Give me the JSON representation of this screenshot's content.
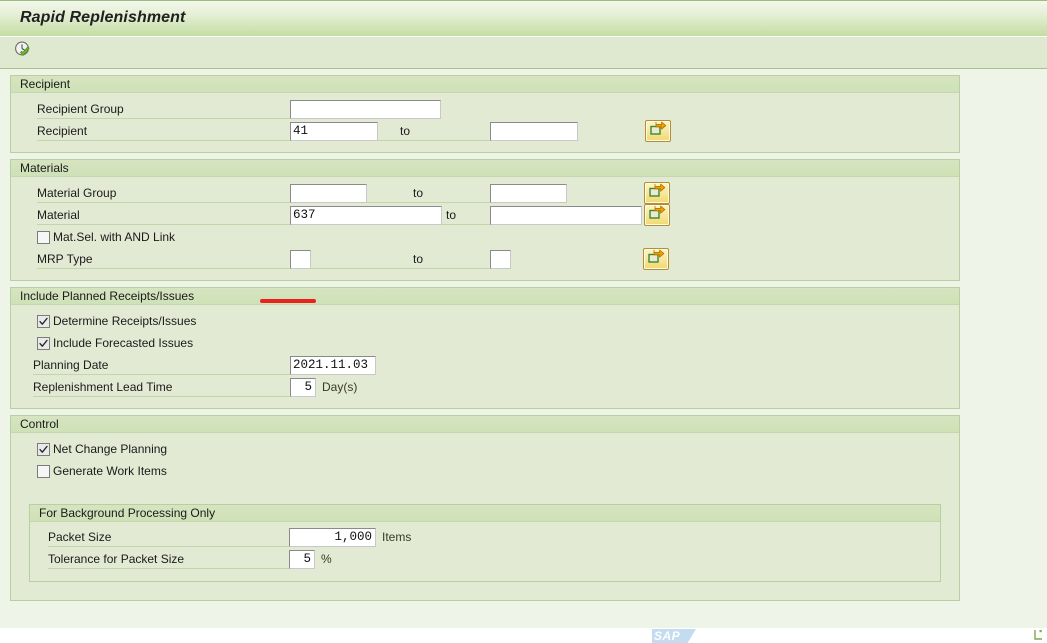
{
  "window": {
    "title": "Rapid Replenishment"
  },
  "toolbar": {
    "execute_button_label": "",
    "execute_icon": "clock-check-icon",
    "execute_tooltip": "Execute"
  },
  "common": {
    "to_label": "to",
    "multi_select_icon": "multi-selection-arrow-icon"
  },
  "sections": {
    "recipient": {
      "title": "Recipient",
      "fields": {
        "recipient_group": {
          "label": "Recipient Group",
          "value": "",
          "placeholder": ""
        },
        "recipient": {
          "label": "Recipient",
          "value": "41",
          "to_value": "",
          "to_label": "to",
          "placeholder": ""
        }
      }
    },
    "materials": {
      "title": "Materials",
      "fields": {
        "material_group": {
          "label": "Material Group",
          "value": "",
          "to_value": "",
          "to_label": "to"
        },
        "material": {
          "label": "Material",
          "value": "637",
          "to_value": "",
          "to_label": "to"
        },
        "mat_sel_and_link": {
          "label": "Mat.Sel. with AND Link",
          "checked": false
        },
        "mrp_type": {
          "label": "MRP Type",
          "value": "",
          "to_value": "",
          "to_label": "to"
        }
      }
    },
    "include_planned": {
      "title": "Include Planned Receipts/Issues",
      "fields": {
        "determine_receipts": {
          "label": "Determine Receipts/Issues",
          "checked": true
        },
        "include_forecasted": {
          "label": "Include Forecasted Issues",
          "checked": true
        },
        "planning_date": {
          "label": "Planning Date",
          "value": "2021.11.03"
        },
        "lead_time": {
          "label": "Replenishment Lead Time",
          "value": "5",
          "unit": "Day(s)"
        }
      }
    },
    "control": {
      "title": "Control",
      "fields": {
        "net_change_planning": {
          "label": "Net Change Planning",
          "checked": true
        },
        "generate_work_items": {
          "label": "Generate Work Items",
          "checked": false
        }
      },
      "background": {
        "title": "For Background Processing Only",
        "fields": {
          "packet_size": {
            "label": "Packet Size",
            "value": "1,000",
            "unit": "Items"
          },
          "tolerance": {
            "label": "Tolerance for Packet Size",
            "value": "5",
            "unit": "%"
          }
        }
      }
    }
  },
  "branding": {
    "logo_text": "SAP"
  },
  "colors": {
    "title_bar_gradient_top": "#f4f9ee",
    "title_bar_gradient_bottom": "#c3dda2",
    "panel_background": "#e2ead4",
    "page_background": "#eef4e8",
    "group_header": "#d6e5c0",
    "annotation_red": "#e8221d",
    "button_yellow": "#f7e59a",
    "sap_logo_blue": "#c4dcf0"
  },
  "annotation": {
    "type": "underline",
    "color": "#e8221d",
    "target": "material-field"
  }
}
